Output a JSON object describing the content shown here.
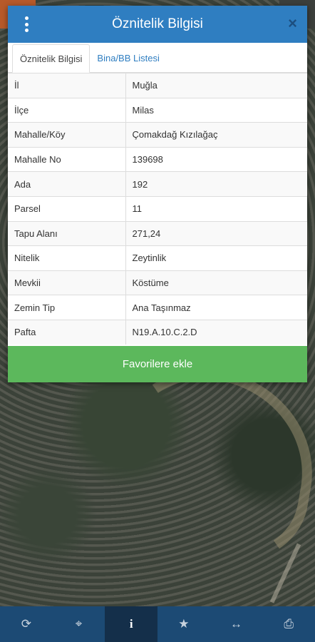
{
  "dialog": {
    "title": "Öznitelik Bilgisi",
    "close_label": "×"
  },
  "tabs": [
    {
      "label": "Öznitelik Bilgisi",
      "active": true
    },
    {
      "label": "Bina/BB Listesi",
      "active": false
    }
  ],
  "attributes": [
    {
      "key": "İl",
      "value": "Muğla"
    },
    {
      "key": "İlçe",
      "value": "Milas"
    },
    {
      "key": "Mahalle/Köy",
      "value": "Çomakdağ Kızılağaç"
    },
    {
      "key": "Mahalle No",
      "value": "139698"
    },
    {
      "key": "Ada",
      "value": "192"
    },
    {
      "key": "Parsel",
      "value": "11"
    },
    {
      "key": "Tapu Alanı",
      "value": "271,24"
    },
    {
      "key": "Nitelik",
      "value": "Zeytinlik"
    },
    {
      "key": "Mevkii",
      "value": "Köstüme"
    },
    {
      "key": "Zemin Tip",
      "value": "Ana Taşınmaz"
    },
    {
      "key": "Pafta",
      "value": "N19.A.10.C.2.D"
    }
  ],
  "favorite_button": "Favorilere ekle",
  "toolbar": {
    "items": [
      {
        "icon": "refresh-icon",
        "glyph": "⟳"
      },
      {
        "icon": "crosshair-icon",
        "glyph": "⌖"
      },
      {
        "icon": "info-icon",
        "glyph": "i"
      },
      {
        "icon": "star-icon",
        "glyph": "★"
      },
      {
        "icon": "measure-icon",
        "glyph": "↔"
      },
      {
        "icon": "print-icon",
        "glyph": "⎙"
      }
    ],
    "active_index": 2
  },
  "colors": {
    "header": "#2f7ec1",
    "button": "#5cb85c",
    "toolbar": "#1c4a74"
  }
}
